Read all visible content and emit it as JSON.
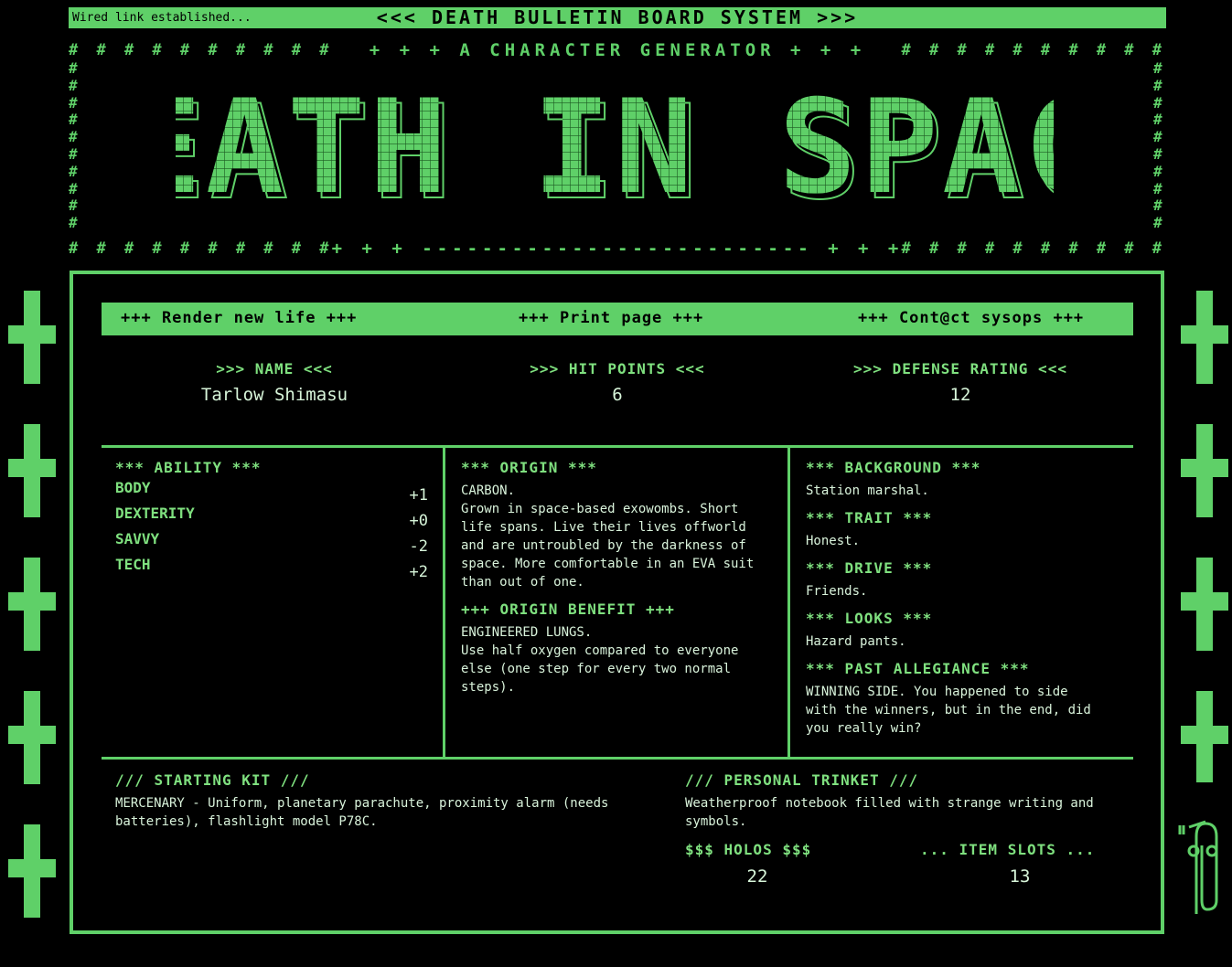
{
  "topbar": {
    "status": "Wired link established...",
    "title": "<<< DEATH BULLETIN BOARD SYSTEM >>>"
  },
  "banner": {
    "subtitle": "+ + +  A CHARACTER GENERATOR  + + +",
    "divider": "+ + +  --------------------------  + + +",
    "hash_left": "# # # # # # # # # #",
    "hash_right": "# # # # # # # # # #",
    "logo_text": "DEATH IN SPACE"
  },
  "menu": {
    "render": "+++ Render new life +++",
    "print": "+++ Print page +++",
    "contact": "+++ Cont@ct sysops +++"
  },
  "stats": {
    "name_label": ">>> NAME <<<",
    "name": "Tarlow Shimasu",
    "hp_label": ">>> HIT POINTS <<<",
    "hp": "6",
    "dr_label": ">>> DEFENSE RATING <<<",
    "dr": "12"
  },
  "ability": {
    "header": "*** ABILITY ***",
    "rows": [
      {
        "name": "BODY",
        "value": "+1"
      },
      {
        "name": "DEXTERITY",
        "value": "+0"
      },
      {
        "name": "SAVVY",
        "value": "-2"
      },
      {
        "name": "TECH",
        "value": "+2"
      }
    ]
  },
  "origin": {
    "header": "*** ORIGIN ***",
    "name": "CARBON.",
    "desc": "Grown in space-based exowombs. Short life spans. Live their lives offworld and are untroubled by the darkness of space. More comfortable in an EVA suit than out of one.",
    "benefit_header": "+++ ORIGIN BENEFIT +++",
    "benefit_name": "ENGINEERED LUNGS.",
    "benefit_desc": "Use half oxygen compared to everyone else (one step for every two normal steps)."
  },
  "details": {
    "background_header": "*** BACKGROUND ***",
    "background": "Station marshal.",
    "trait_header": "*** TRAIT ***",
    "trait": "Honest.",
    "drive_header": "*** DRIVE ***",
    "drive": "Friends.",
    "looks_header": "*** LOOKS ***",
    "looks": "Hazard pants.",
    "allegiance_header": "*** PAST ALLEGIANCE ***",
    "allegiance": "WINNING SIDE. You happened to side with the winners, but in the end, did you really win?"
  },
  "kit": {
    "header": "/// STARTING KIT ///",
    "text": "MERCENARY - Uniform, planetary parachute, proximity alarm (needs batteries), flashlight model P78C."
  },
  "trinket": {
    "header": "/// PERSONAL TRINKET ///",
    "text": "Weatherproof notebook filled with strange writing and symbols."
  },
  "holos": {
    "header": "$$$ HOLOS $$$",
    "value": "22"
  },
  "slots": {
    "header": "... ITEM SLOTS ...",
    "value": "13"
  },
  "colors": {
    "accent": "#5fd068",
    "background": "#000000"
  }
}
